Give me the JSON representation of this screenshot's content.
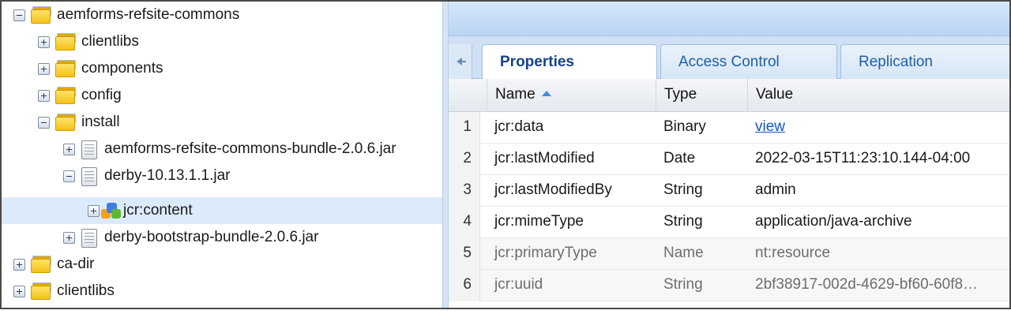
{
  "tree": {
    "items": [
      {
        "label": "aemforms-refsite-commons",
        "toggle": "minus",
        "icon": "folder-icon",
        "depth": 0
      },
      {
        "label": "clientlibs",
        "toggle": "plus",
        "icon": "folder-icon",
        "depth": 1
      },
      {
        "label": "components",
        "toggle": "plus",
        "icon": "folder-icon",
        "depth": 1
      },
      {
        "label": "config",
        "toggle": "plus",
        "icon": "folder-icon",
        "depth": 1
      },
      {
        "label": "install",
        "toggle": "minus",
        "icon": "folder-icon",
        "depth": 1
      },
      {
        "label": "aemforms-refsite-commons-bundle-2.0.6.jar",
        "toggle": "plus",
        "icon": "file-icon",
        "depth": 2
      },
      {
        "label": "derby-10.13.1.1.jar",
        "toggle": "minus",
        "icon": "file-icon",
        "depth": 2
      },
      {
        "label": "jcr:content",
        "toggle": "plus",
        "icon": "node-icon",
        "depth": 3,
        "selected": true
      },
      {
        "label": "derby-bootstrap-bundle-2.0.6.jar",
        "toggle": "plus",
        "icon": "file-icon",
        "depth": 2
      },
      {
        "label": "ca-dir",
        "toggle": "plus",
        "icon": "folder-icon",
        "depth": 0
      },
      {
        "label": "clientlibs",
        "toggle": "plus",
        "icon": "folder-icon",
        "depth": 0
      }
    ]
  },
  "tabs": [
    {
      "label": "Properties",
      "active": true
    },
    {
      "label": "Access Control",
      "active": false
    },
    {
      "label": "Replication",
      "active": false
    }
  ],
  "grid": {
    "columns": {
      "name": "Name",
      "type": "Type",
      "value": "Value"
    },
    "sort": {
      "column": "Name",
      "direction": "ascending"
    },
    "rows": [
      {
        "num": "1",
        "name": "jcr:data",
        "type": "Binary",
        "value": "view",
        "link": true,
        "dim": false
      },
      {
        "num": "2",
        "name": "jcr:lastModified",
        "type": "Date",
        "value": "2022-03-15T11:23:10.144-04:00",
        "link": false,
        "dim": false
      },
      {
        "num": "3",
        "name": "jcr:lastModifiedBy",
        "type": "String",
        "value": "admin",
        "link": false,
        "dim": false
      },
      {
        "num": "4",
        "name": "jcr:mimeType",
        "type": "String",
        "value": "application/java-archive",
        "link": false,
        "dim": false
      },
      {
        "num": "5",
        "name": "jcr:primaryType",
        "type": "Name",
        "value": "nt:resource",
        "link": false,
        "dim": true
      },
      {
        "num": "6",
        "name": "jcr:uuid",
        "type": "String",
        "value": "2bf38917-002d-4629-bf60-60f8…",
        "link": false,
        "dim": true
      }
    ]
  },
  "colors": {
    "accent": "#15428b",
    "selection": "#dcebfc",
    "link": "#1155cc"
  }
}
